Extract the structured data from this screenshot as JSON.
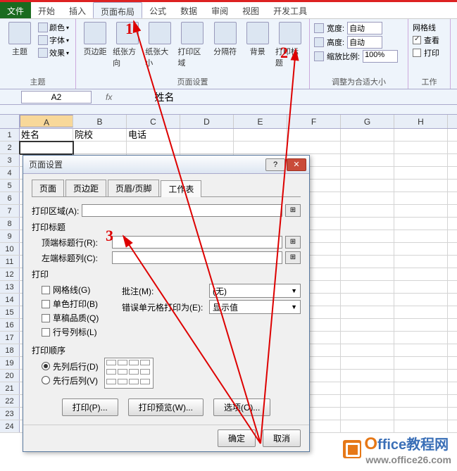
{
  "tabs": {
    "file": "文件",
    "home": "开始",
    "insert": "插入",
    "layout": "页面布局",
    "formulas": "公式",
    "data": "数据",
    "review": "审阅",
    "view": "视图",
    "dev": "开发工具"
  },
  "ribbon": {
    "themes": {
      "colors": "颜色",
      "fonts": "字体",
      "effects": "效果",
      "themes_btn": "主题",
      "group": "主题"
    },
    "pagesetup": {
      "margins": "页边距",
      "orientation": "纸张方向",
      "size": "纸张大小",
      "printarea": "打印区域",
      "breaks": "分隔符",
      "background": "背景",
      "titles": "打印标题",
      "group": "页面设置"
    },
    "scale": {
      "width": "宽度:",
      "height": "高度:",
      "scale": "缩放比例:",
      "auto": "自动",
      "pct": "100%",
      "group": "调整为合适大小"
    },
    "gridlines": {
      "label": "网格线",
      "view": "查看",
      "print": "打印",
      "group": "工作"
    }
  },
  "formula_bar": {
    "name": "A2",
    "fx": "fx",
    "value": "姓名"
  },
  "cols": [
    "A",
    "B",
    "C",
    "D",
    "E",
    "F",
    "G",
    "H"
  ],
  "rownums": [
    "1",
    "2",
    "3",
    "4",
    "5",
    "6",
    "7",
    "8",
    "9",
    "10",
    "11",
    "12",
    "13",
    "14",
    "15",
    "16",
    "17",
    "18",
    "19",
    "20",
    "21",
    "22",
    "23",
    "24"
  ],
  "cells": {
    "a1": "姓名",
    "b1": "院校",
    "c1": "电话"
  },
  "dialog": {
    "title": "页面设置",
    "tabs": {
      "page": "页面",
      "margins": "页边距",
      "hf": "页眉/页脚",
      "sheet": "工作表"
    },
    "print_area": "打印区域(A):",
    "print_titles": "打印标题",
    "top_rows": "顶端标题行(R):",
    "left_cols": "左端标题列(C):",
    "print_sec": "打印",
    "gridlines": "网格线(G)",
    "bw": "单色打印(B)",
    "draft": "草稿品质(Q)",
    "rowcol": "行号列标(L)",
    "comments": "批注(M):",
    "comments_val": "(无)",
    "errors": "错误单元格打印为(E):",
    "errors_val": "显示值",
    "order_sec": "打印顺序",
    "down_over": "先列后行(D)",
    "over_down": "先行后列(V)",
    "print_btn": "打印(P)...",
    "preview_btn": "打印预览(W)...",
    "options_btn": "选项(O)...",
    "ok": "确定",
    "cancel": "取消"
  },
  "annotations": {
    "n1": "1",
    "n2": "2",
    "n3": "3"
  },
  "watermark": {
    "brand1": "O",
    "brand2": "ffice",
    "brand3": "教程网",
    "url": "www.office26.com"
  }
}
